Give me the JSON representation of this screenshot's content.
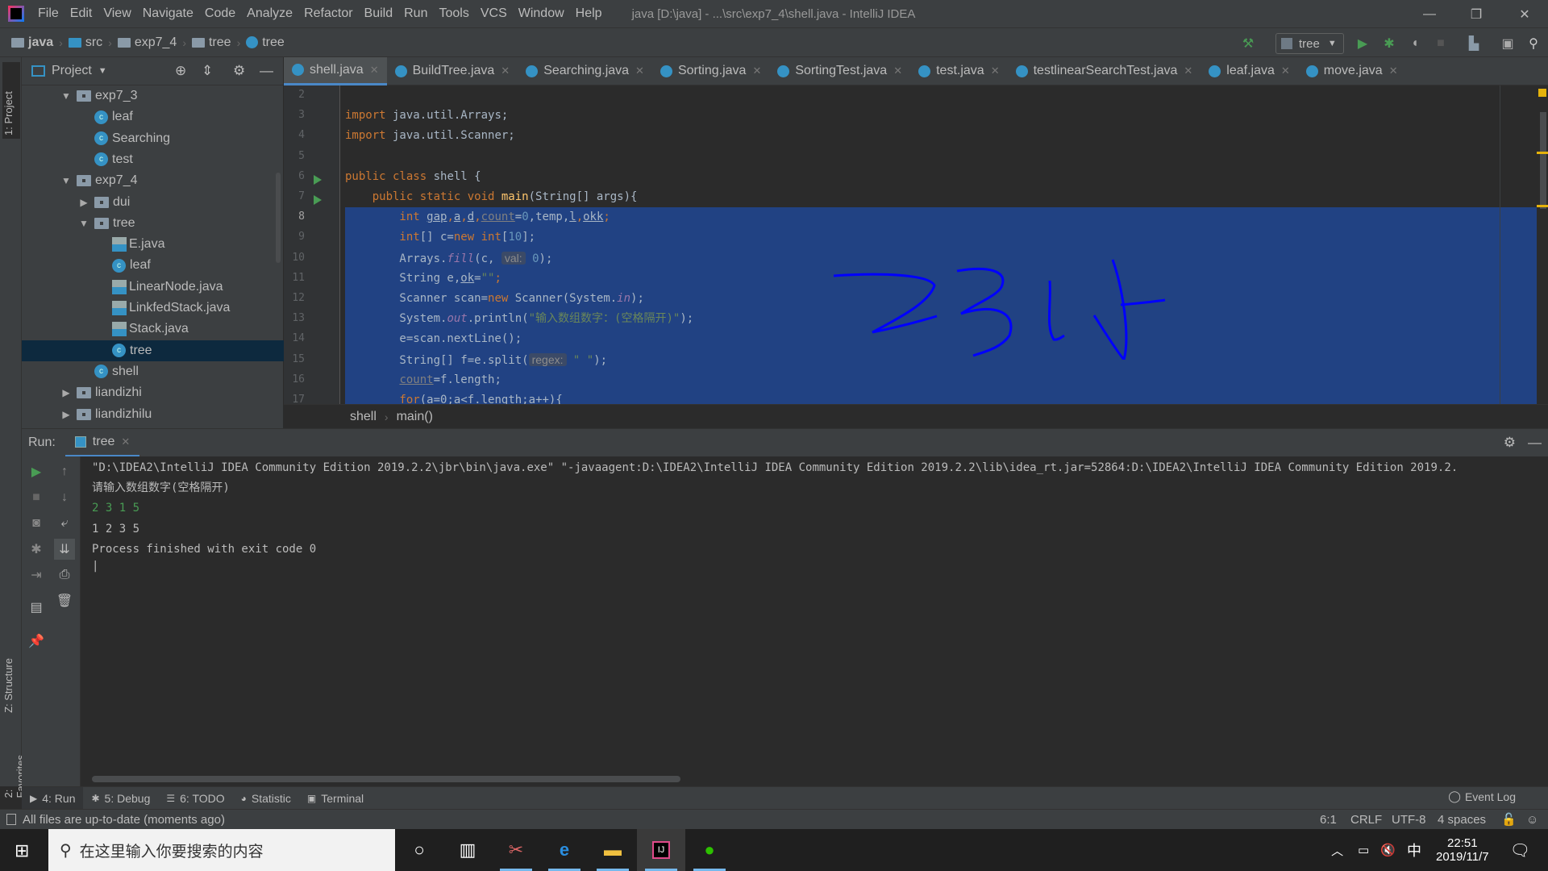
{
  "window": {
    "title": "java [D:\\java] - ...\\src\\exp7_4\\shell.java - IntelliJ IDEA",
    "menu": [
      "File",
      "Edit",
      "View",
      "Navigate",
      "Code",
      "Analyze",
      "Refactor",
      "Build",
      "Run",
      "Tools",
      "VCS",
      "Window",
      "Help"
    ],
    "controls": {
      "minimize": "—",
      "restore": "❐",
      "close": "✕"
    }
  },
  "navbar": {
    "breadcrumb": [
      "java",
      "src",
      "exp7_4",
      "tree",
      "tree"
    ],
    "run_config": "tree"
  },
  "side_tabs": {
    "project": "1: Project",
    "structure": "Z: Structure",
    "favorites": "2: Favorites"
  },
  "project_panel": {
    "title": "Project",
    "tree": [
      {
        "label": "exp7_3",
        "type": "folder",
        "expanded": true,
        "level": 1
      },
      {
        "label": "leaf",
        "type": "class",
        "level": 2
      },
      {
        "label": "Searching",
        "type": "class",
        "level": 2
      },
      {
        "label": "test",
        "type": "class",
        "level": 2
      },
      {
        "label": "exp7_4",
        "type": "folder",
        "expanded": true,
        "level": 1
      },
      {
        "label": "dui",
        "type": "folder",
        "expanded": false,
        "level": 2
      },
      {
        "label": "tree",
        "type": "folder",
        "expanded": true,
        "level": 2
      },
      {
        "label": "E.java",
        "type": "java",
        "level": 3
      },
      {
        "label": "leaf",
        "type": "class",
        "level": 3
      },
      {
        "label": "LinearNode.java",
        "type": "java",
        "level": 3
      },
      {
        "label": "LinkfedStack.java",
        "type": "java",
        "level": 3
      },
      {
        "label": "Stack.java",
        "type": "java",
        "level": 3
      },
      {
        "label": "tree",
        "type": "class",
        "level": 3,
        "selected": true
      },
      {
        "label": "shell",
        "type": "class",
        "level": 2
      },
      {
        "label": "liandizhi",
        "type": "folder",
        "expanded": false,
        "level": 1
      },
      {
        "label": "liandizhilu",
        "type": "folder",
        "expanded": false,
        "level": 1
      }
    ]
  },
  "editor_tabs": [
    {
      "label": "shell.java",
      "active": true
    },
    {
      "label": "BuildTree.java"
    },
    {
      "label": "Searching.java"
    },
    {
      "label": "Sorting.java"
    },
    {
      "label": "SortingTest.java"
    },
    {
      "label": "test.java"
    },
    {
      "label": "testlinearSearchTest.java"
    },
    {
      "label": "leaf.java"
    },
    {
      "label": "move.java"
    }
  ],
  "editor": {
    "line_numbers": [
      "2",
      "3",
      "4",
      "5",
      "6",
      "7",
      "8",
      "9",
      "10",
      "11",
      "12",
      "13",
      "14",
      "15",
      "16",
      "17"
    ],
    "lines": {
      "l3a": "import",
      "l3b": " java.util.Arrays;",
      "l4a": "import",
      "l4b": " java.util.Scanner;",
      "l6a": "public class",
      "l6b": " shell {",
      "l7a": "    public static void ",
      "l7b": "main",
      "l7c": "(String[] args){",
      "l8a": "        int ",
      "l8b": "gap",
      "l8c": ",",
      "l8d": "a",
      "l8e": ",",
      "l8f": "d",
      "l8g": ",",
      "l8h": "count",
      "l8i": "=",
      "l8j": "0",
      ",temp,": ",temp,",
      "l8k": "l",
      "l8l": ",",
      "l8m": "okk",
      "l8n": ";",
      "l9a": "        int",
      "l9b": "[] c=",
      "l9c": "new int",
      "l9d": "[",
      "l9e": "10",
      "l9f": "];",
      "l10a": "        Arrays.",
      "l10b": "fill",
      "l10c": "(c, ",
      "l10hint": "val:",
      "l10d": " 0",
      "l10e": ");",
      "l11a": "        String e,",
      "l11b": "ok",
      "l11c": "=",
      "l11d": "\"\"",
      "l11e": ";",
      "l12a": "        Scanner scan=",
      "l12b": "new",
      "l12c": " Scanner(System.",
      "l12d": "in",
      "l12e": ");",
      "l13a": "        System.",
      "l13b": "out",
      "l13c": ".println(",
      "l13d": "\"输入数组数字：(空格隔开)\"",
      "l13e": ");",
      "l14a": "        e=scan.nextLine();",
      "l15a": "        String[] f=e.split(",
      "l15hint": "regex:",
      "l15d": " \" \"",
      "l15e": ");",
      "l16a": "        ",
      "l16b": "count",
      "l16c": "=f.length;",
      "l17a": "        for",
      "l17b": "(",
      "l17c": "a",
      "l17d": "=0;",
      "l17e": "a",
      "l17f": "<f.length;",
      "l17g": "a",
      "l17h": "++){"
    },
    "handwriting": "2315",
    "breadcrumb": [
      "shell",
      "main()"
    ]
  },
  "run_panel": {
    "label": "Run:",
    "tab": "tree",
    "console": [
      {
        "text": "\"D:\\IDEA2\\IntelliJ IDEA Community Edition 2019.2.2\\jbr\\bin\\java.exe\" \"-javaagent:D:\\IDEA2\\IntelliJ IDEA Community Edition 2019.2.2\\lib\\idea_rt.jar=52864:D:\\IDEA2\\IntelliJ IDEA Community Edition 2019.2.",
        "kind": "cmd"
      },
      {
        "text": "请输入数组数字(空格隔开)",
        "kind": "out"
      },
      {
        "text": "2 3 1 5",
        "kind": "input"
      },
      {
        "text": "1 2 3 5",
        "kind": "out"
      },
      {
        "text": "Process finished with exit code 0",
        "kind": "out"
      }
    ]
  },
  "tool_windows": [
    {
      "label": "4: Run",
      "icon": "play-icon",
      "active": true
    },
    {
      "label": "5: Debug",
      "icon": "bug-icon"
    },
    {
      "label": "6: TODO",
      "icon": "list-icon"
    },
    {
      "label": "Statistic",
      "icon": "statistic-icon"
    },
    {
      "label": "Terminal",
      "icon": "terminal-icon"
    }
  ],
  "event_log": "Event Log",
  "status": {
    "message": "All files are up-to-date (moments ago)",
    "position": "6:1",
    "line_sep": "CRLF",
    "encoding": "UTF-8",
    "indent": "4 spaces"
  },
  "taskbar": {
    "search_placeholder": "在这里输入你要搜索的内容",
    "ime": "中",
    "time": "22:51",
    "date": "2019/11/7"
  },
  "colors": {
    "selection": "#214283",
    "accent": "#4a88c7",
    "run_green": "#499c54",
    "ink": "#0000ff"
  }
}
